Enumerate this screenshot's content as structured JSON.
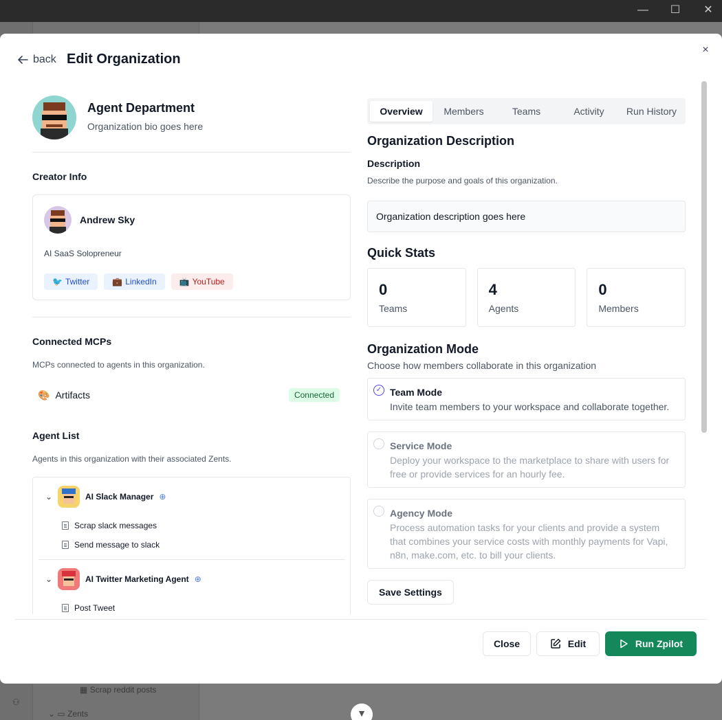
{
  "window": {
    "minimize": "—",
    "maximize": "☐",
    "close": "✕"
  },
  "background": {
    "zent_item": "Scrap reddit posts",
    "zents_folder": "Zents"
  },
  "modal": {
    "back_label": "back",
    "title": "Edit Organization",
    "close": "×"
  },
  "organization": {
    "name": "Agent Department",
    "bio": "Organization bio goes here"
  },
  "creator": {
    "section_title": "Creator Info",
    "name": "Andrew Sky",
    "role": "AI SaaS Solopreneur",
    "socials": [
      {
        "icon": "🐦",
        "label": "Twitter"
      },
      {
        "icon": "💼",
        "label": "LinkedIn"
      },
      {
        "icon": "📺",
        "label": "YouTube"
      }
    ]
  },
  "mcps": {
    "title": "Connected MCPs",
    "subtitle": "MCPs connected to agents in this organization.",
    "items": [
      {
        "icon": "🎨",
        "name": "Artifacts",
        "status": "Connected"
      }
    ]
  },
  "agents": {
    "title": "Agent List",
    "subtitle": "Agents in this organization with their associated Zents.",
    "items": [
      {
        "name": "AI Slack Manager",
        "zents": [
          "Scrap slack messages",
          "Send message to slack"
        ]
      },
      {
        "name": "AI Twitter Marketing Agent",
        "zents": [
          "Post Tweet"
        ]
      }
    ]
  },
  "tabs": [
    "Overview",
    "Members",
    "Teams",
    "Activity",
    "Run History"
  ],
  "overview": {
    "heading": "Organization Description",
    "desc_label": "Description",
    "desc_help": "Describe the purpose and goals of this organization.",
    "desc_value": "Organization description goes here",
    "stats_heading": "Quick Stats",
    "stats": [
      {
        "value": "0",
        "label": "Teams"
      },
      {
        "value": "4",
        "label": "Agents"
      },
      {
        "value": "0",
        "label": "Members"
      }
    ],
    "mode_heading": "Organization Mode",
    "mode_sub": "Choose how members collaborate in this organization",
    "modes": [
      {
        "title": "Team Mode",
        "desc": "Invite team members to your workspace and collaborate together.",
        "selected": true
      },
      {
        "title": "Service Mode",
        "desc": "Deploy your workspace to the marketplace to share with users for free or provide services for an hourly fee.",
        "selected": false
      },
      {
        "title": "Agency Mode",
        "desc": "Process automation tasks for your clients and provide a system that combines your service costs with monthly payments for Vapi, n8n, make.com, etc. to bill your clients.",
        "selected": false
      }
    ],
    "save_label": "Save Settings"
  },
  "footer": {
    "close_label": "Close",
    "edit_label": "Edit",
    "run_label": "Run Zpilot"
  },
  "colors": {
    "primary": "#15885a",
    "accent": "#4f46e5"
  }
}
